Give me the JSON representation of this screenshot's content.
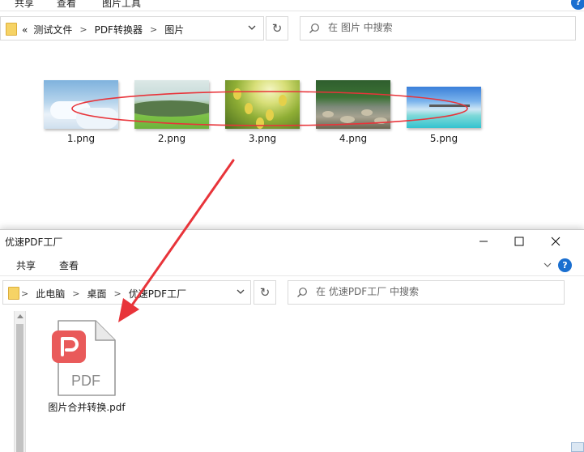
{
  "top_window": {
    "ribbon_tabs": [
      {
        "label": "共享"
      },
      {
        "label": "查看"
      },
      {
        "label": "图片工具"
      }
    ],
    "help_label": "?",
    "nav": {
      "overflow_label": "«",
      "breadcrumb": [
        "测试文件",
        "PDF转换器",
        "图片"
      ]
    },
    "search": {
      "placeholder": "在 图片 中搜索"
    },
    "files": [
      {
        "name": "1.png"
      },
      {
        "name": "2.png"
      },
      {
        "name": "3.png"
      },
      {
        "name": "4.png"
      },
      {
        "name": "5.png"
      }
    ]
  },
  "bottom_window": {
    "title": "优速PDF工厂",
    "ribbon_tabs": [
      {
        "label": "共享"
      },
      {
        "label": "查看"
      }
    ],
    "help_label": "?",
    "nav": {
      "breadcrumb": [
        "此电脑",
        "桌面",
        "优速PDF工厂"
      ]
    },
    "search": {
      "placeholder": "在 优速PDF工厂 中搜索"
    },
    "file": {
      "name": "图片合并转换.pdf",
      "icon_text": "PDF"
    }
  },
  "colors": {
    "annotation_red": "#e8343a",
    "pdf_badge_red": "#e95a5a",
    "help_blue": "#1a6fd0"
  }
}
